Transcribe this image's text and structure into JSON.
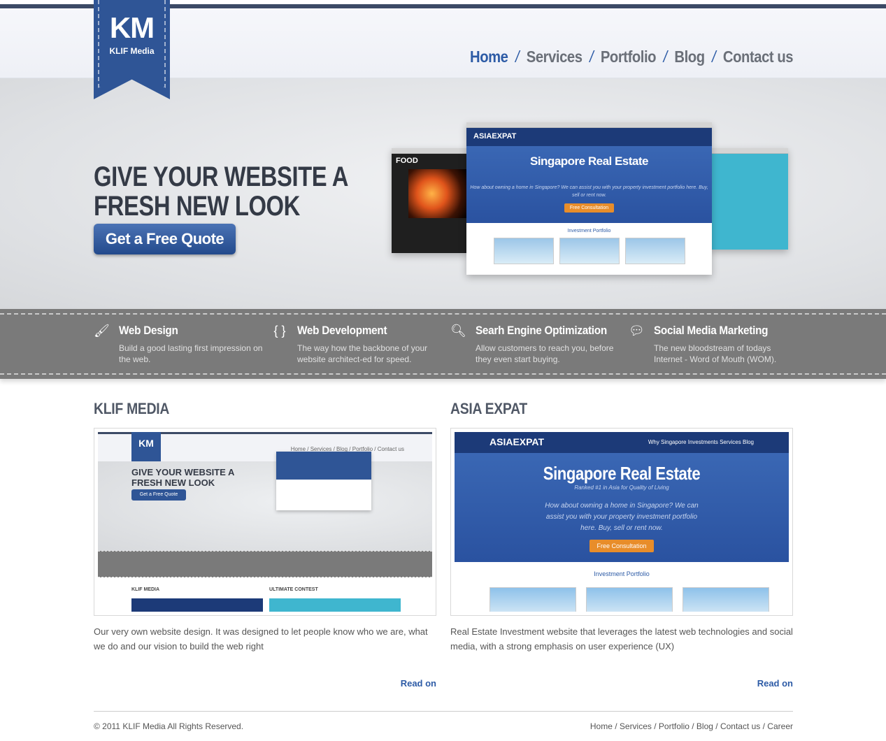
{
  "brand": {
    "logo_initials": "KM",
    "name": "KLIF Media"
  },
  "nav": [
    {
      "label": "Home",
      "active": true
    },
    {
      "label": "Services"
    },
    {
      "label": "Portfolio"
    },
    {
      "label": "Blog"
    },
    {
      "label": "Contact us"
    }
  ],
  "nav_separator": "/",
  "hero": {
    "headline_line1": "GIVE YOUR WEBSITE A",
    "headline_line2": "FRESH NEW LOOK",
    "cta_label": "Get a Free Quote",
    "preview": {
      "left_title": "FOOD",
      "main_logo": "ASIAEXPAT",
      "main_title": "Singapore Real Estate",
      "main_tagline": "Ranked #1 in Asia for Quality of Living",
      "main_text": "How about owning a home in Singapore? We can assist you with your property investment portfolio here. Buy, sell or rent now.",
      "main_button": "Free Consultation",
      "main_section": "Investment Portfolio"
    }
  },
  "services": [
    {
      "icon": "brush-icon",
      "title": "Web Design",
      "text": "Build a good lasting first impression on the web."
    },
    {
      "icon": "braces-icon",
      "title": "Web Development",
      "text": "The way how the backbone of your website architect-ed for speed."
    },
    {
      "icon": "search-icon",
      "title": "Searh Engine Optimization",
      "text": "Allow customers to reach you, before they even start buying."
    },
    {
      "icon": "chat-icon",
      "title": "Social Media Marketing",
      "text": "The new bloodstream of todays Internet - Word of Mouth (WOM)."
    }
  ],
  "portfolio": [
    {
      "title": "KLIF MEDIA",
      "description": "Our very own website design. It was designed to let people know who we are, what we do and our vision to build the web right",
      "read_label": "Read on",
      "thumb": {
        "logo": "KM",
        "nav": "Home / Services / Blog / Portfolio / Contact us",
        "headline": "GIVE YOUR WEBSITE A FRESH NEW LOOK",
        "cta": "Get a Free Quote",
        "col1": "KLIF MEDIA",
        "col2": "ULTIMATE CONTEST"
      }
    },
    {
      "title": "ASIA EXPAT",
      "description": "Real Estate Investment website that leverages the latest web technologies and social media, with a strong emphasis on user experience (UX)",
      "read_label": "Read on",
      "thumb": {
        "logo": "ASIAEXPAT",
        "nav": "Why Singapore   Investments   Services   Blog",
        "title": "Singapore Real Estate",
        "tagline": "Ranked #1 in Asia for Quality of Living",
        "text": "How about owning a home in Singapore? We can assist you with your property investment portfolio here. Buy, sell or rent now.",
        "button": "Free Consultation",
        "section": "Investment Portfolio"
      }
    }
  ],
  "footer": {
    "copyright": "© 2011 KLIF Media All Rights Reserved.",
    "links": "Home / Services / Portfolio / Blog / Contact us / Career"
  }
}
